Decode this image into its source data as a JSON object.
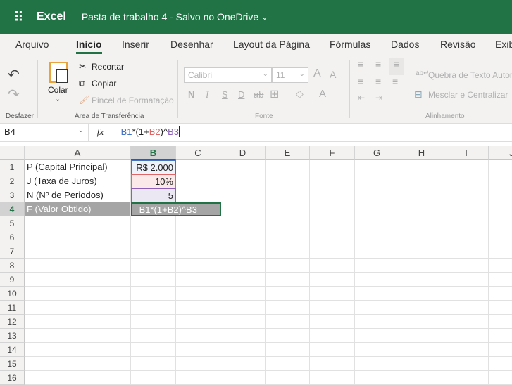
{
  "header": {
    "app": "Excel",
    "doc_title": "Pasta de trabalho 4 - Salvo no OneDrive"
  },
  "tabs": [
    "Arquivo",
    "Início",
    "Inserir",
    "Desenhar",
    "Layout da Página",
    "Fórmulas",
    "Dados",
    "Revisão",
    "Exib"
  ],
  "ribbon": {
    "undo_group": "Desfazer",
    "paste": "Colar",
    "cut": "Recortar",
    "copy": "Copiar",
    "format_painter": "Pincel de Formatação",
    "clipboard_group": "Área de Transferência",
    "font_name": "Calibri",
    "font_size": "11",
    "bold": "N",
    "italic": "I",
    "underline": "S",
    "double_underline": "D",
    "strike": "ab",
    "font_group": "Fonte",
    "wrap_text": "Quebra de Texto Autor",
    "merge": "Mesclar e Centralizar",
    "alignment_group": "Alinhamento",
    "grow": "A",
    "shrink": "A",
    "font_color": "A"
  },
  "formula_bar": {
    "name_box": "B4",
    "fx": "fx",
    "formula_parts": [
      "=",
      "B1",
      "*(1+",
      "B2",
      ")^",
      "B3"
    ]
  },
  "columns": [
    "A",
    "B",
    "C",
    "D",
    "E",
    "F",
    "G",
    "H",
    "I",
    "J"
  ],
  "rows": [
    "1",
    "2",
    "3",
    "4",
    "5",
    "6",
    "7",
    "8",
    "9",
    "10",
    "11",
    "12",
    "13",
    "14",
    "15",
    "16"
  ],
  "cells": {
    "A1": "P (Capital Principal)",
    "B1": "R$ 2.000",
    "A2": "J (Taxa de Juros)",
    "B2": "10%",
    "A3": "N (Nº de Periodos)",
    "B3": "5",
    "A4": "F (Valor Obtido)",
    "B4": "=B1*(1+B2)^B3"
  },
  "colors": {
    "brand": "#217346",
    "ref1": "#4472c4",
    "ref2": "#e06666",
    "ref3": "#8e5fb8"
  }
}
